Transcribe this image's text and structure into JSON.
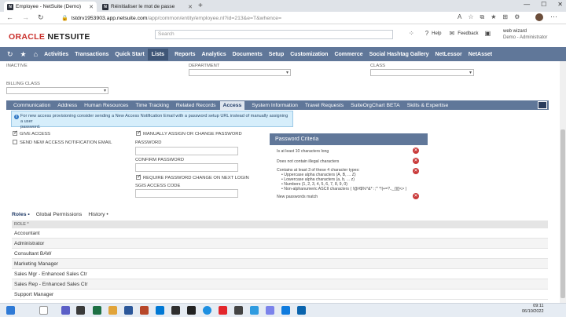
{
  "browser": {
    "tabs": [
      {
        "title": "Employee - NetSuite (Demo)",
        "active": true
      },
      {
        "title": "Réinitialiser le mot de passe",
        "active": false
      }
    ],
    "url_host": "tstdrv1953903.app.netsuite.com",
    "url_path": "/app/common/entity/employee.nl?id=213&e=T&whence="
  },
  "header": {
    "logo_a": "ORACLE",
    "logo_b": "NETSUITE",
    "search_placeholder": "Search",
    "help": "Help",
    "feedback": "Feedback",
    "user_name": "web wizard",
    "user_role": "Demo - Administrator"
  },
  "mainnav": [
    "Activities",
    "Transactions",
    "Quick Start",
    "Lists",
    "Reports",
    "Analytics",
    "Documents",
    "Setup",
    "Customization",
    "Commerce",
    "Social Hashtag Gallery",
    "NetLessor",
    "NetAsset"
  ],
  "form": {
    "inactive": "INACTIVE",
    "department": "DEPARTMENT",
    "class": "CLASS",
    "billing_class": "BILLING CLASS"
  },
  "subtabs": [
    "Communication",
    "Address",
    "Human Resources",
    "Time Tracking",
    "Related Records",
    "Access",
    "System Information",
    "Travel Requests",
    "SuiteOrgChart BETA",
    "Skills & Expertise"
  ],
  "info": {
    "line1": "For new access provisioning consider sending a New Access Notification Email with a password setup URL instead of manually assigning a user",
    "line2": "password."
  },
  "access": {
    "give_access": "GIVE ACCESS",
    "send_notification": "SEND NEW ACCESS NOTIFICATION EMAIL",
    "manually_assign": "MANUALLY ASSIGN OR CHANGE PASSWORD",
    "password": "PASSWORD",
    "confirm_password": "CONFIRM PASSWORD",
    "require_change": "REQUIRE PASSWORD CHANGE ON NEXT LOGIN",
    "sgis_code": "SGIS ACCESS CODE"
  },
  "criteria": {
    "title": "Password Criteria",
    "c1": "Is at least 10 characters long",
    "c2": "Does not contain illegal characters",
    "c3": "Contains at least 3 of these 4 character types:",
    "c3a": "• Uppercase alpha characters (A, B, ... Z)",
    "c3b": "• Lowercase alpha characters (a, b, ... z)",
    "c3c": "• Numbers (1, 2, 3, 4, 5, 6, 7, 8, 9, 0)",
    "c3d": "• Non-alphanumeric ASCII characters ( !@#$%^&* :;\"' *!|+=?.,_{}[]<> )",
    "c4": "New passwords match"
  },
  "roles": {
    "tab_roles": "Roles •",
    "tab_global": "Global Permissions",
    "tab_history": "History •",
    "col_role": "ROLE *",
    "rows": [
      "Accountant",
      "Administrator",
      "Consultant BAW",
      "Marketing Manager",
      "Sales Mgr - Enhanced Sales Ctr",
      "Sales Rep - Enhanced Sales Ctr",
      "Support Manager"
    ]
  },
  "clock": {
    "time": "09:11",
    "date": "06/10/2022"
  }
}
